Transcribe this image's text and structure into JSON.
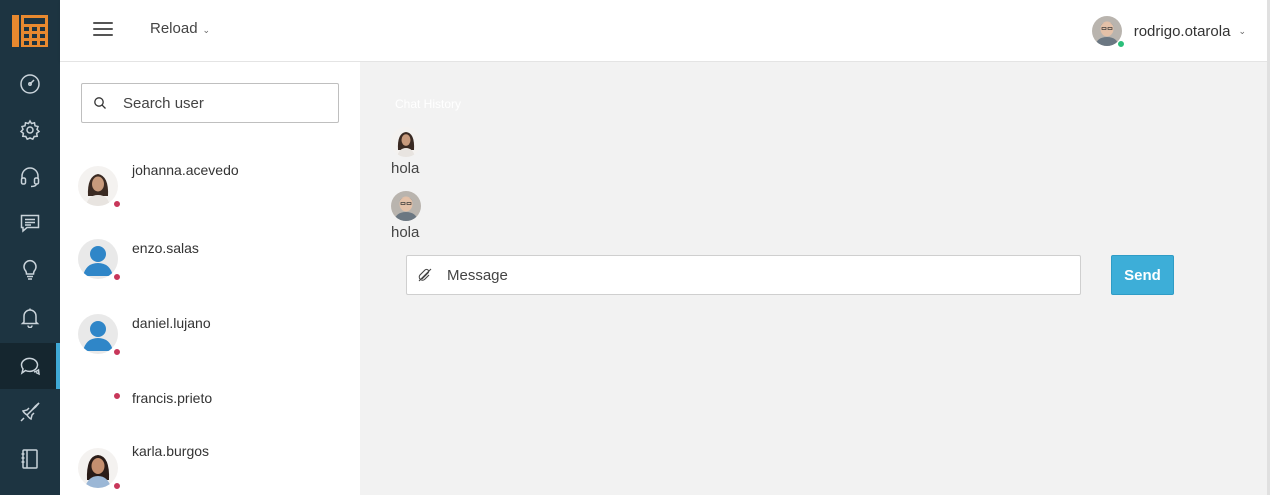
{
  "topbar": {
    "reload_label": "Reload",
    "user_name": "rodrigo.otarola"
  },
  "sidebar": {
    "items": [
      {
        "icon": "dashboard-icon"
      },
      {
        "icon": "gear-icon"
      },
      {
        "icon": "headset-icon"
      },
      {
        "icon": "message-icon"
      },
      {
        "icon": "lightbulb-icon"
      },
      {
        "icon": "bell-icon"
      },
      {
        "icon": "chat-bubbles-icon",
        "active": true
      },
      {
        "icon": "rocket-icon"
      },
      {
        "icon": "notebook-icon"
      }
    ]
  },
  "users": {
    "search_placeholder": "Search user",
    "list": [
      {
        "name": "johanna.acevedo",
        "status": "offline",
        "avatar": "photo"
      },
      {
        "name": "enzo.salas",
        "status": "offline",
        "avatar": "default"
      },
      {
        "name": "daniel.lujano",
        "status": "offline",
        "avatar": "default"
      },
      {
        "name": "francis.prieto",
        "status": "offline",
        "avatar": "none"
      },
      {
        "name": "karla.burgos",
        "status": "offline",
        "avatar": "photo"
      }
    ]
  },
  "chat": {
    "title": "Chat History",
    "messages": [
      {
        "text": "hola",
        "sender": "johanna.acevedo"
      },
      {
        "text": "hola",
        "sender": "rodrigo.otarola"
      }
    ],
    "message_placeholder": "Message",
    "send_label": "Send"
  },
  "colors": {
    "rail": "#1d3441",
    "accent": "#3daed8",
    "offline_dot": "#c8375a",
    "online_dot": "#2bbf7a",
    "logo": "#e8892f"
  }
}
